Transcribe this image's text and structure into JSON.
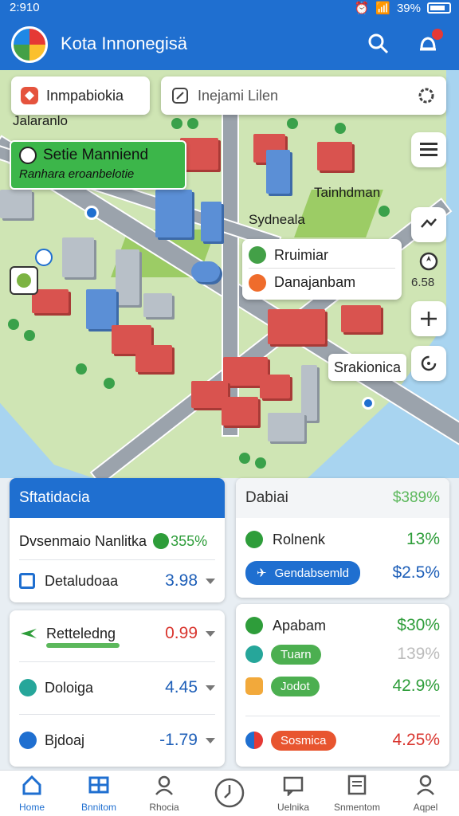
{
  "status": {
    "time": "2:910",
    "battery": "39%"
  },
  "header": {
    "title": "Kota Innonegisä"
  },
  "map": {
    "location_chip": "Inmpabiokia",
    "search_placeholder": "Inejami Lilen",
    "highlight_card": {
      "title": "Setie Manniend",
      "subtitle": "Ranhara eroanbelotie"
    },
    "labels": {
      "label_left": "Jalaranlo",
      "label_right": "Tainhdman",
      "label_park": "Sydneala"
    },
    "poi_card": {
      "item1": "Rruimiar",
      "item2": "Danajanbam"
    },
    "time_label": "6.58",
    "callout": "Srakionica"
  },
  "stats_left": {
    "title": "Sftatidacia",
    "rows": [
      {
        "label": "Dvsenmaio Nanlitka",
        "value": "355%"
      },
      {
        "label": "Detaludoaa",
        "value": "3.98"
      },
      {
        "label": "Retteledng",
        "value": "0.99"
      },
      {
        "label": "Doloiga",
        "value": "4.45"
      },
      {
        "label": "Bjdoaj",
        "value": "-1.79"
      }
    ]
  },
  "stats_right": {
    "title": "Dabiai",
    "title_value": "$389%",
    "rows": [
      {
        "label": "Rolnenk",
        "value": "13%"
      },
      {
        "label": "Gendabsemld",
        "value": "$2.5%"
      },
      {
        "label": "Apabam",
        "value": "$30%"
      },
      {
        "label": "Tuarn",
        "value": "139%"
      },
      {
        "label": "Jodot",
        "value": "42.9%"
      },
      {
        "label": "Sosmica",
        "value": "4.25%"
      }
    ]
  },
  "nav": [
    {
      "label": "Home"
    },
    {
      "label": "Bnnitom"
    },
    {
      "label": "Rhocia"
    },
    {
      "label": ""
    },
    {
      "label": "Uelnika"
    },
    {
      "label": "Snmentom"
    },
    {
      "label": "Aqpel"
    }
  ],
  "colors": {
    "primary": "#1f6fd0",
    "positive": "#2e9d3a",
    "negative": "#d9362f",
    "neutral": "#1e5fb8"
  }
}
